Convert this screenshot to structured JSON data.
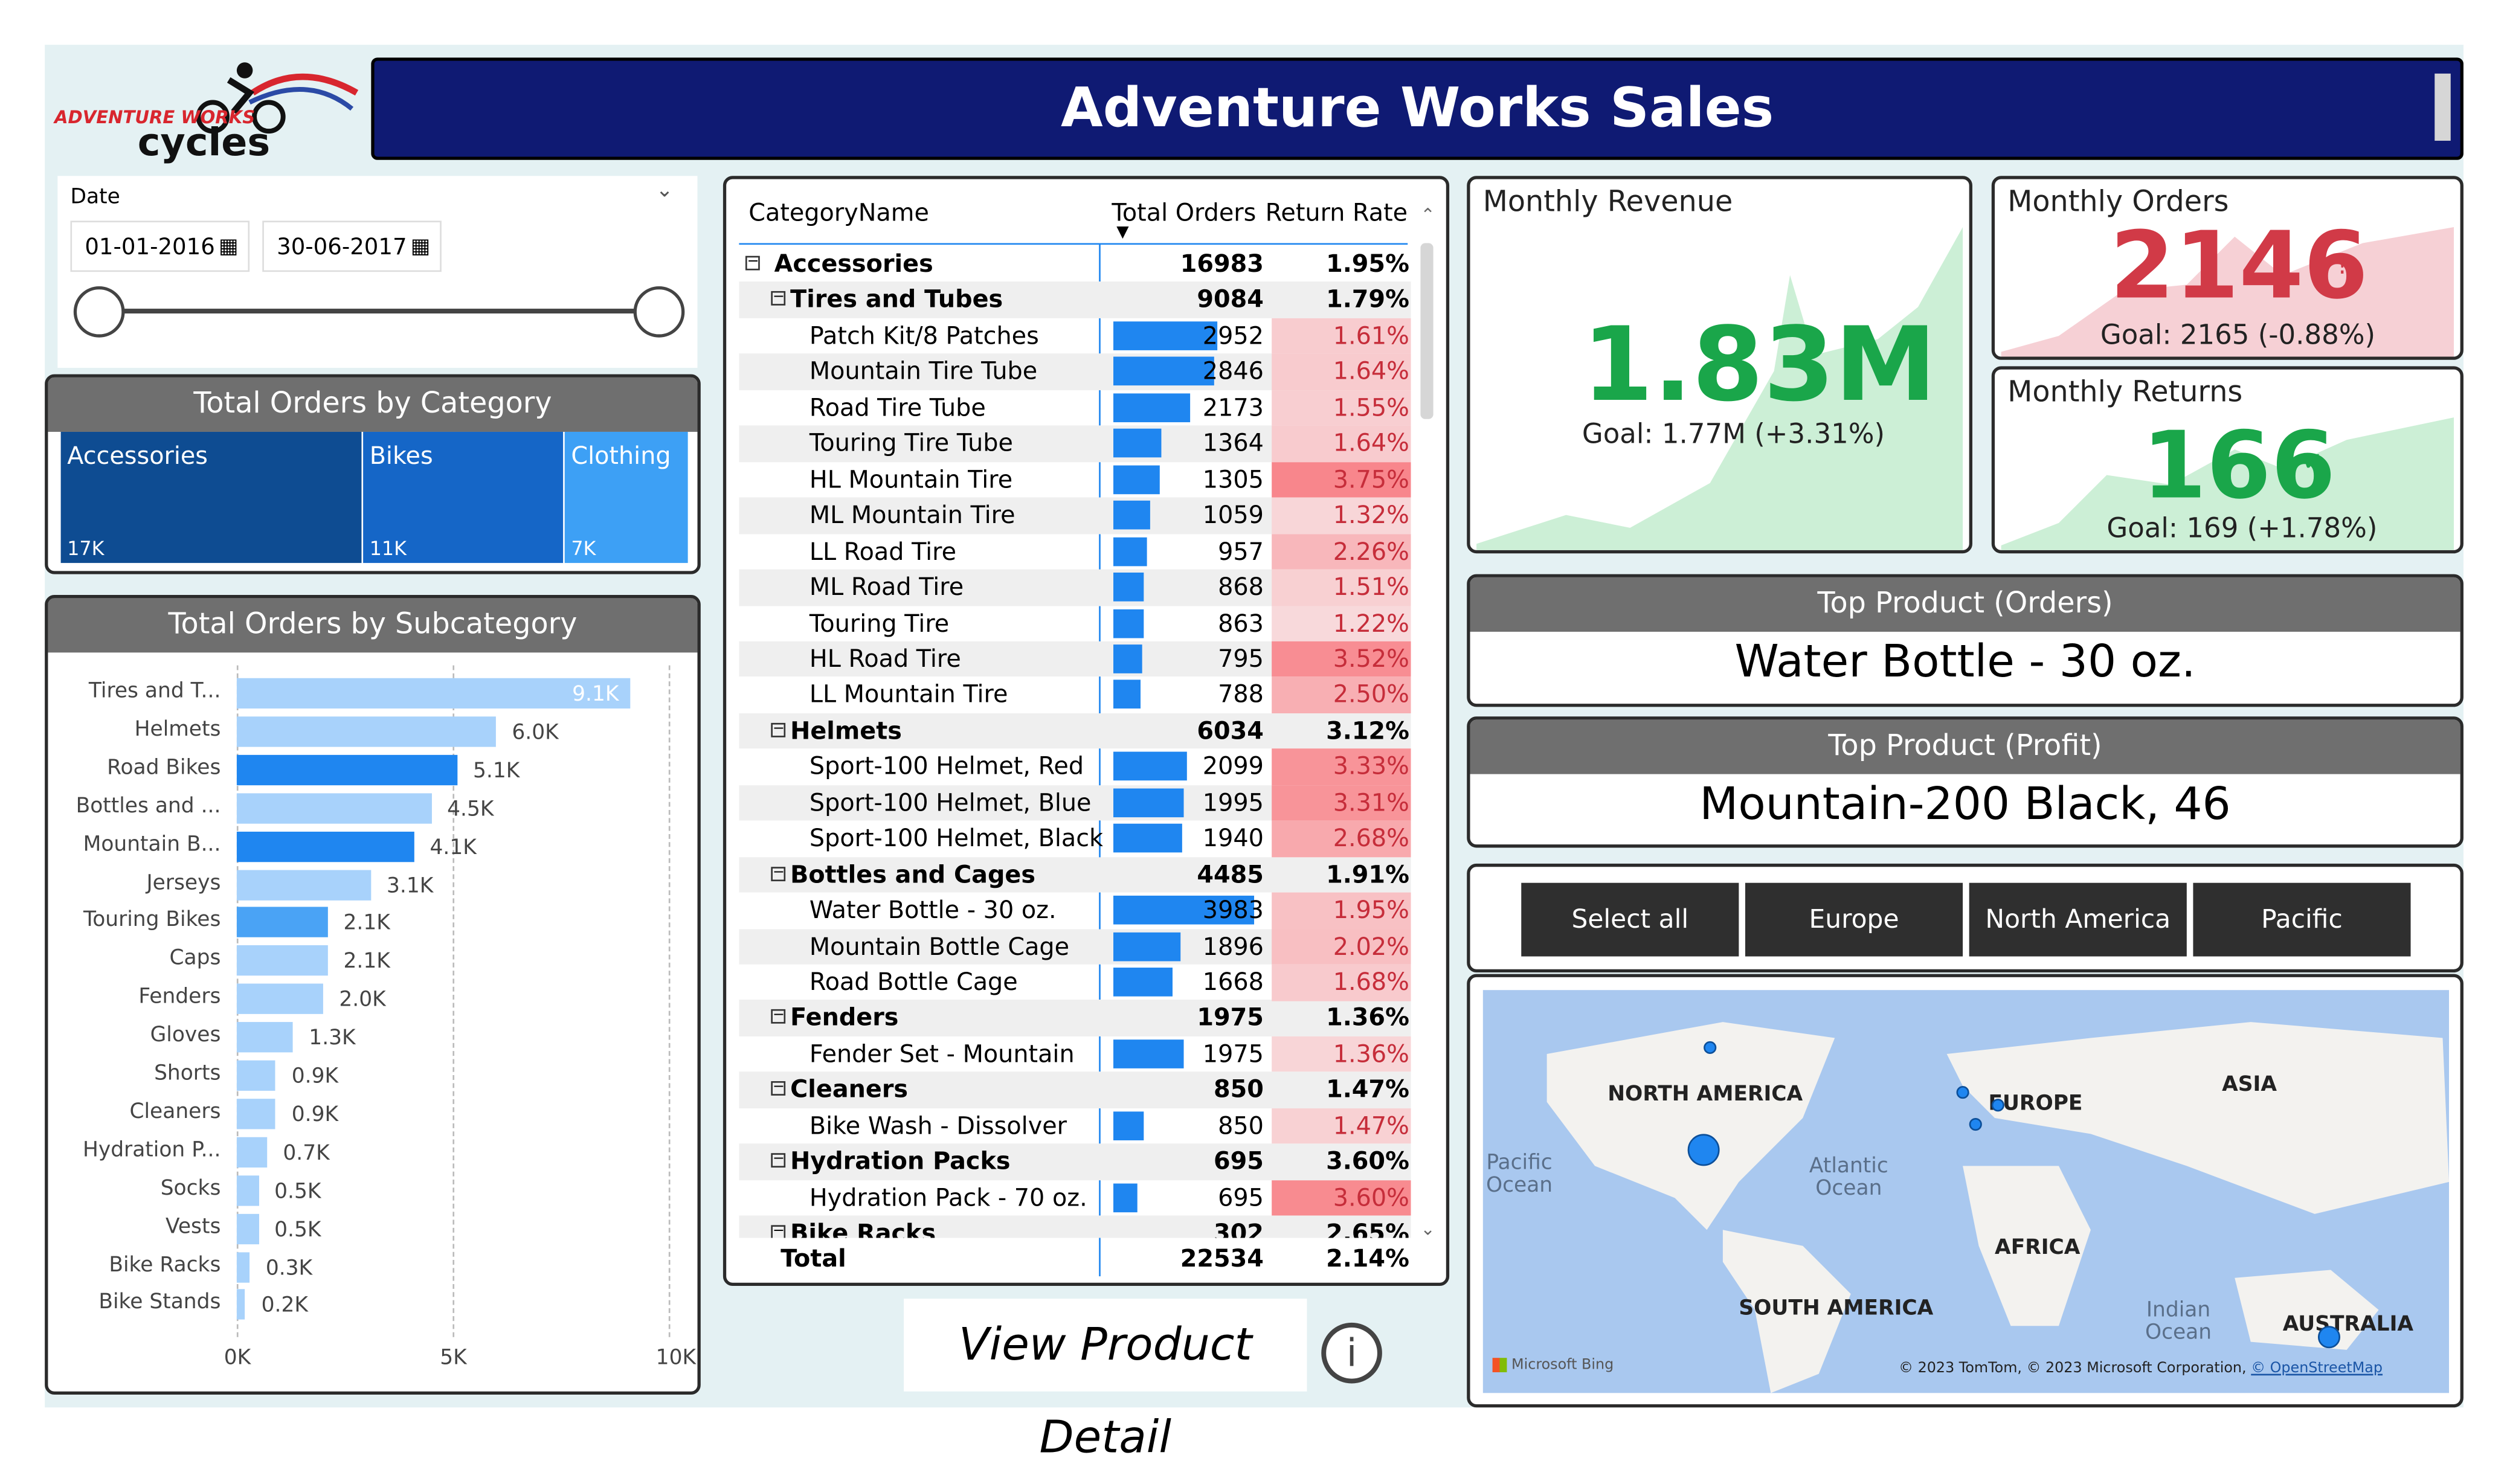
{
  "header": {
    "title": "Adventure Works Sales",
    "logo_line1": "ADVENTURE WORKS",
    "logo_line2": "cycles"
  },
  "date_filter": {
    "label": "Date",
    "start": "01-01-2016",
    "end": "30-06-2017"
  },
  "category_chart": {
    "title": "Total Orders by Category",
    "tiles": [
      {
        "name": "Accessories",
        "value": "17K",
        "color": "#0e4c92"
      },
      {
        "name": "Bikes",
        "value": "11K",
        "color": "#1566c7"
      },
      {
        "name": "Clothing",
        "value": "7K",
        "color": "#3da0f5"
      }
    ]
  },
  "chart_data": {
    "type": "bar",
    "title": "Total Orders by Subcategory",
    "categories": [
      "Tires and T...",
      "Helmets",
      "Road Bikes",
      "Bottles and ...",
      "Mountain B...",
      "Jerseys",
      "Touring Bikes",
      "Caps",
      "Fenders",
      "Gloves",
      "Shorts",
      "Cleaners",
      "Hydration P...",
      "Socks",
      "Vests",
      "Bike Racks",
      "Bike Stands"
    ],
    "values": [
      9100,
      6000,
      5100,
      4500,
      4100,
      3100,
      2100,
      2100,
      2000,
      1300,
      900,
      900,
      700,
      500,
      500,
      300,
      200
    ],
    "value_labels": [
      "9.1K",
      "6.0K",
      "5.1K",
      "4.5K",
      "4.1K",
      "3.1K",
      "2.1K",
      "2.1K",
      "2.0K",
      "1.3K",
      "0.9K",
      "0.9K",
      "0.7K",
      "0.5K",
      "0.5K",
      "0.3K",
      "0.2K"
    ],
    "bar_colors": [
      "#a8d2fb",
      "#a8d2fb",
      "#1f86f0",
      "#a8d2fb",
      "#1f86f0",
      "#a8d2fb",
      "#4aa3f5",
      "#a8d2fb",
      "#a8d2fb",
      "#a8d2fb",
      "#a8d2fb",
      "#a8d2fb",
      "#a8d2fb",
      "#a8d2fb",
      "#a8d2fb",
      "#a8d2fb",
      "#a8d2fb"
    ],
    "xlim": [
      0,
      10000
    ],
    "x_ticks": [
      "0K",
      "5K",
      "10K"
    ],
    "grid": true
  },
  "matrix": {
    "headers": {
      "category": "CategoryName",
      "orders": "Total Orders",
      "rate": "Return Rate"
    },
    "rows": [
      {
        "name": "Accessories",
        "orders": "16983",
        "rate": "1.95%",
        "level": 0,
        "bold": true
      },
      {
        "name": "Tires and Tubes",
        "orders": "9084",
        "rate": "1.79%",
        "level": 1,
        "bold": true
      },
      {
        "name": "Patch Kit/8 Patches",
        "orders": "2952",
        "rate": "1.61%",
        "level": 2,
        "bar": 2952,
        "heat": 1.61
      },
      {
        "name": "Mountain Tire Tube",
        "orders": "2846",
        "rate": "1.64%",
        "level": 2,
        "bar": 2846,
        "heat": 1.64
      },
      {
        "name": "Road Tire Tube",
        "orders": "2173",
        "rate": "1.55%",
        "level": 2,
        "bar": 2173,
        "heat": 1.55
      },
      {
        "name": "Touring Tire Tube",
        "orders": "1364",
        "rate": "1.64%",
        "level": 2,
        "bar": 1364,
        "heat": 1.64
      },
      {
        "name": "HL Mountain Tire",
        "orders": "1305",
        "rate": "3.75%",
        "level": 2,
        "bar": 1305,
        "heat": 3.75
      },
      {
        "name": "ML Mountain Tire",
        "orders": "1059",
        "rate": "1.32%",
        "level": 2,
        "bar": 1059,
        "heat": 1.32
      },
      {
        "name": "LL Road Tire",
        "orders": "957",
        "rate": "2.26%",
        "level": 2,
        "bar": 957,
        "heat": 2.26
      },
      {
        "name": "ML Road Tire",
        "orders": "868",
        "rate": "1.51%",
        "level": 2,
        "bar": 868,
        "heat": 1.51
      },
      {
        "name": "Touring Tire",
        "orders": "863",
        "rate": "1.22%",
        "level": 2,
        "bar": 863,
        "heat": 1.22
      },
      {
        "name": "HL Road Tire",
        "orders": "795",
        "rate": "3.52%",
        "level": 2,
        "bar": 795,
        "heat": 3.52
      },
      {
        "name": "LL Mountain Tire",
        "orders": "788",
        "rate": "2.50%",
        "level": 2,
        "bar": 788,
        "heat": 2.5
      },
      {
        "name": "Helmets",
        "orders": "6034",
        "rate": "3.12%",
        "level": 1,
        "bold": true
      },
      {
        "name": "Sport-100 Helmet, Red",
        "orders": "2099",
        "rate": "3.33%",
        "level": 2,
        "bar": 2099,
        "heat": 3.33
      },
      {
        "name": "Sport-100 Helmet, Blue",
        "orders": "1995",
        "rate": "3.31%",
        "level": 2,
        "bar": 1995,
        "heat": 3.31
      },
      {
        "name": "Sport-100 Helmet, Black",
        "orders": "1940",
        "rate": "2.68%",
        "level": 2,
        "bar": 1940,
        "heat": 2.68
      },
      {
        "name": "Bottles and Cages",
        "orders": "4485",
        "rate": "1.91%",
        "level": 1,
        "bold": true
      },
      {
        "name": "Water Bottle - 30 oz.",
        "orders": "3983",
        "rate": "1.95%",
        "level": 2,
        "bar": 3983,
        "heat": 1.95
      },
      {
        "name": "Mountain Bottle Cage",
        "orders": "1896",
        "rate": "2.02%",
        "level": 2,
        "bar": 1896,
        "heat": 2.02
      },
      {
        "name": "Road Bottle Cage",
        "orders": "1668",
        "rate": "1.68%",
        "level": 2,
        "bar": 1668,
        "heat": 1.68
      },
      {
        "name": "Fenders",
        "orders": "1975",
        "rate": "1.36%",
        "level": 1,
        "bold": true
      },
      {
        "name": "Fender Set - Mountain",
        "orders": "1975",
        "rate": "1.36%",
        "level": 2,
        "bar": 1975,
        "heat": 1.36
      },
      {
        "name": "Cleaners",
        "orders": "850",
        "rate": "1.47%",
        "level": 1,
        "bold": true
      },
      {
        "name": "Bike Wash - Dissolver",
        "orders": "850",
        "rate": "1.47%",
        "level": 2,
        "bar": 850,
        "heat": 1.47
      },
      {
        "name": "Hydration Packs",
        "orders": "695",
        "rate": "3.60%",
        "level": 1,
        "bold": true
      },
      {
        "name": "Hydration Pack - 70 oz.",
        "orders": "695",
        "rate": "3.60%",
        "level": 2,
        "bar": 695,
        "heat": 3.6
      },
      {
        "name": "Bike Racks",
        "orders": "302",
        "rate": "2.65%",
        "level": 1,
        "bold": true
      }
    ],
    "total": {
      "label": "Total",
      "orders": "22534",
      "rate": "2.14%"
    }
  },
  "view_detail": {
    "label": "View Product Detail",
    "info_glyph": "i"
  },
  "kpis": {
    "revenue": {
      "label": "Monthly Revenue",
      "value": "1.83M",
      "goal": "Goal: 1.77M (+3.31%)",
      "status": "good",
      "color": "#1aa64a"
    },
    "orders": {
      "label": "Monthly Orders",
      "value": "2146",
      "goal": "Goal: 2165 (-0.88%)",
      "status": "bad",
      "color": "#d13a47"
    },
    "returns": {
      "label": "Monthly Returns",
      "value": "166",
      "goal": "Goal: 169 (+1.78%)",
      "status": "good",
      "color": "#1aa64a"
    }
  },
  "top_product_orders": {
    "title": "Top Product (Orders)",
    "value": "Water Bottle - 30 oz."
  },
  "top_product_profit": {
    "title": "Top Product (Profit)",
    "value": "Mountain-200 Black, 46"
  },
  "region_slicer": {
    "options": [
      "Select all",
      "Europe",
      "North America",
      "Pacific"
    ]
  },
  "map": {
    "continents": [
      "NORTH AMERICA",
      "EUROPE",
      "ASIA",
      "AFRICA",
      "SOUTH AMERICA",
      "AUSTRALIA"
    ],
    "oceans": [
      "Pacific\nOcean",
      "Atlantic\nOcean",
      "Indian\nOcean"
    ],
    "provider": "Microsoft Bing",
    "attribution": "© 2023 TomTom, © 2023 Microsoft Corporation,",
    "attribution_link": "© OpenStreetMap"
  }
}
